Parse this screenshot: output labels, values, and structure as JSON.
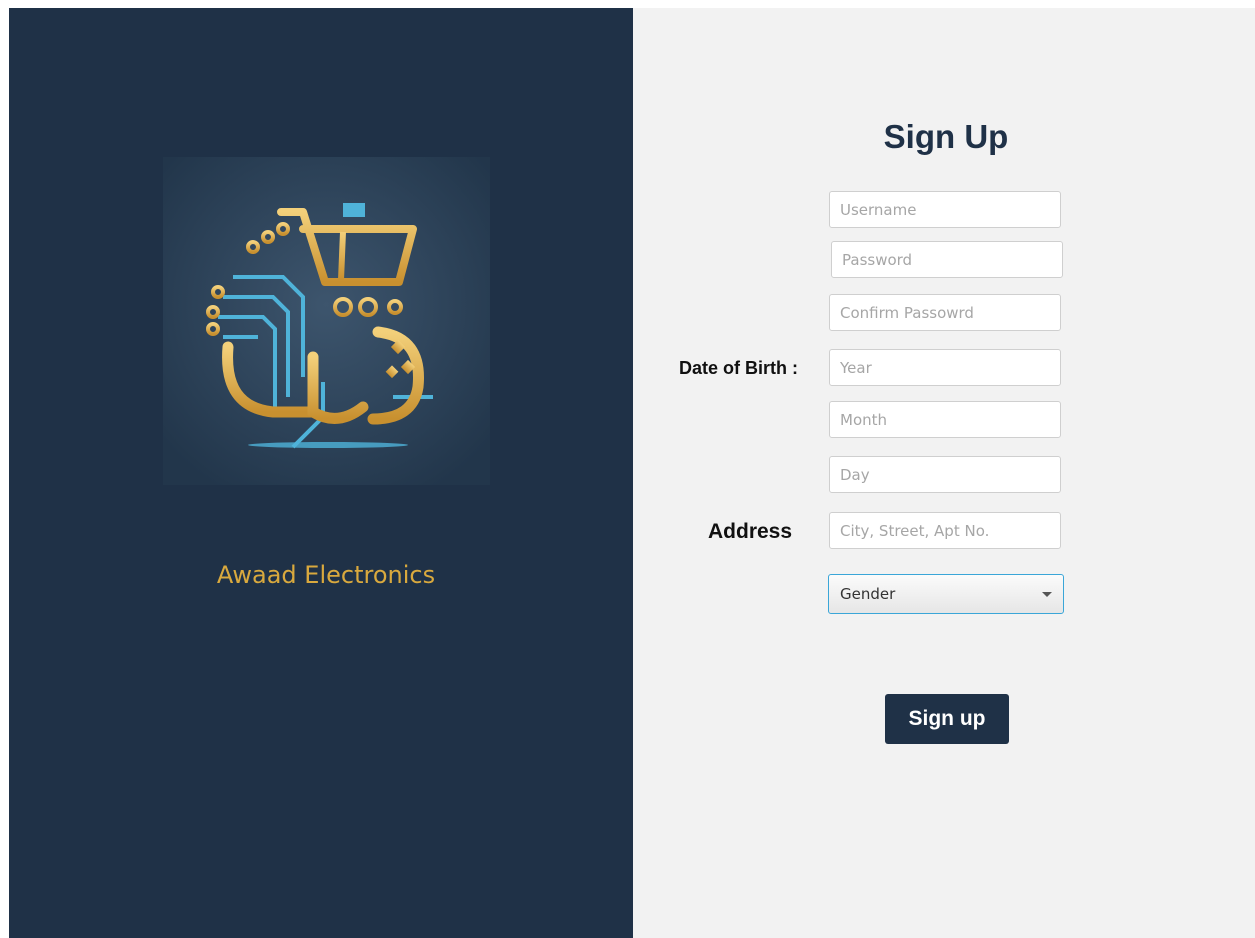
{
  "brand": {
    "name": "Awaad Electronics",
    "logo_icon": "shopping-cart-circuit-logo",
    "colors": {
      "panel": "#1f3147",
      "gold": "#d9a93e",
      "circuit": "#4fb3d9"
    }
  },
  "form": {
    "title": "Sign Up",
    "username_placeholder": "Username",
    "password_placeholder": "Password",
    "confirm_placeholder": "Confirm Passowrd",
    "dob_label": "Date of Birth :",
    "year_placeholder": "Year",
    "month_placeholder": "Month",
    "day_placeholder": "Day",
    "address_label": "Address",
    "address_placeholder": "City, Street, Apt No.",
    "gender_value": "Gender",
    "submit_label": "Sign up"
  }
}
